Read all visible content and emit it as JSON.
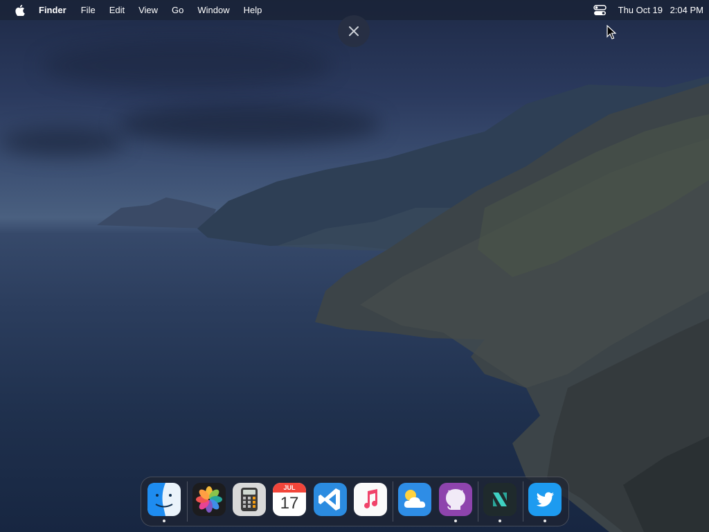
{
  "menubar": {
    "app_name": "Finder",
    "items": [
      "File",
      "Edit",
      "View",
      "Go",
      "Window",
      "Help"
    ],
    "date": "Thu Oct 19",
    "time": "2:04 PM"
  },
  "overlay": {
    "close_icon": "close-icon"
  },
  "dock": {
    "apps": [
      {
        "name": "Finder",
        "icon": "finder-icon",
        "running": true
      },
      {
        "name": "Photos",
        "icon": "photos-icon",
        "running": false
      },
      {
        "name": "Calculator",
        "icon": "calculator-icon",
        "running": false
      },
      {
        "name": "Calendar",
        "icon": "calendar-icon",
        "running": false,
        "month": "JUL",
        "day": "17"
      },
      {
        "name": "Visual Studio Code",
        "icon": "vscode-icon",
        "running": false
      },
      {
        "name": "Music",
        "icon": "music-icon",
        "running": false
      },
      {
        "name": "Weather",
        "icon": "weather-icon",
        "running": false
      },
      {
        "name": "GitHub",
        "icon": "github-icon",
        "running": true
      },
      {
        "name": "Sublime/Script",
        "icon": "script-s-icon",
        "running": true
      },
      {
        "name": "Twitter",
        "icon": "twitter-icon",
        "running": true
      }
    ]
  },
  "colors": {
    "menubar_bg": "#1a2236",
    "calendar_red": "#f2453a",
    "twitter_blue": "#1d9bf0"
  }
}
